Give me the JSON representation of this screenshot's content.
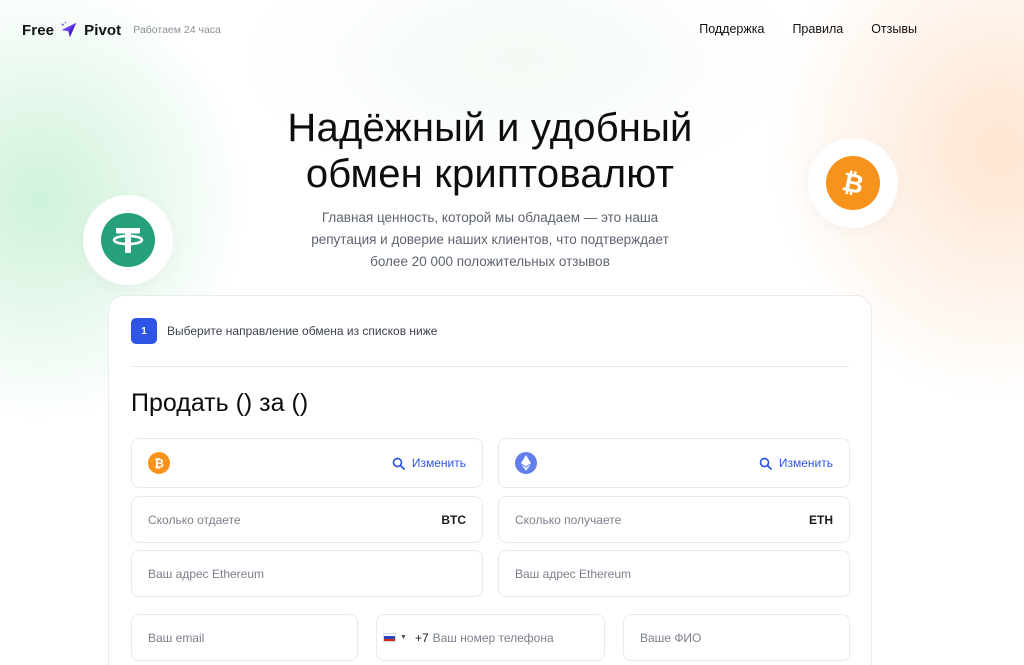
{
  "header": {
    "logo_left": "Free",
    "logo_right": "Pivot",
    "tagline": "Работаем 24 часа",
    "nav": [
      "Поддержка",
      "Правила",
      "Отзывы"
    ]
  },
  "hero": {
    "title_line1": "Надёжный и удобный",
    "title_line2": "обмен криптовалют",
    "subtitle_line1": "Главная ценность, которой мы обладаем — это наша",
    "subtitle_line2": "репутация и доверие наших клиентов, что подтверждает",
    "subtitle_line3": "более 20 000 положительных отзывов"
  },
  "exchange": {
    "step_number": "1",
    "step_text": "Выберите направление обмена из списков ниже",
    "title": "Продать () за ()",
    "change_label": "Изменить",
    "give_placeholder": "Сколько отдаете",
    "give_currency": "BTC",
    "get_placeholder": "Сколько получаете",
    "get_currency": "ETH",
    "address_placeholder_left": "Ваш адрес Ethereum",
    "address_placeholder_right": "Ваш адрес Ethereum",
    "email_placeholder": "Ваш email",
    "phone_code": "+7",
    "phone_placeholder": "Ваш номер телефона",
    "name_placeholder": "Ваше ФИО"
  },
  "colors": {
    "accent": "#2f55e6",
    "bitcoin": "#f7931a",
    "tether": "#26a17b",
    "ethereum": "#627eea"
  },
  "icons": {
    "logo": "paper-plane-icon",
    "usdt": "tether-icon",
    "btc": "bitcoin-icon",
    "eth": "ethereum-icon",
    "search": "search-icon"
  }
}
